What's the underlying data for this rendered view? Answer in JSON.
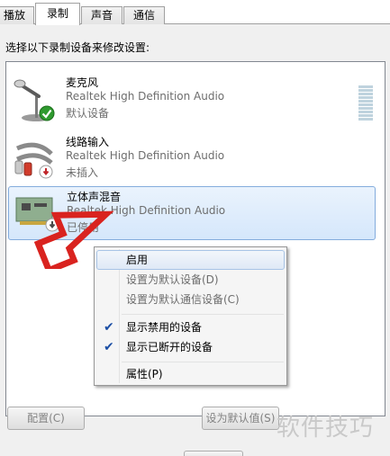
{
  "tabs": [
    {
      "label": "播放"
    },
    {
      "label": "录制"
    },
    {
      "label": "声音"
    },
    {
      "label": "通信"
    }
  ],
  "instruction": "选择以下录制设备来修改设置:",
  "devices": [
    {
      "name": "麦克风",
      "driver": "Realtek High Definition Audio",
      "status": "默认设备",
      "icon": "microphone-icon",
      "badge": "check-badge-icon"
    },
    {
      "name": "线路输入",
      "driver": "Realtek High Definition Audio",
      "status": "未插入",
      "icon": "line-in-cable-icon",
      "badge": "unplugged-badge-icon"
    },
    {
      "name": "立体声混音",
      "driver": "Realtek High Definition Audio",
      "status": "已停用",
      "icon": "sound-card-icon",
      "badge": "disabled-badge-icon"
    }
  ],
  "context_menu": {
    "items": [
      {
        "label": "启用",
        "enabled": true,
        "checked": false
      },
      {
        "label": "设置为默认设备(D)",
        "enabled": false,
        "checked": false
      },
      {
        "label": "设置为默认通信设备(C)",
        "enabled": false,
        "checked": false
      },
      {
        "label": "显示禁用的设备",
        "enabled": true,
        "checked": true
      },
      {
        "label": "显示已断开的设备",
        "enabled": true,
        "checked": true
      },
      {
        "label": "属性(P)",
        "enabled": true,
        "checked": false
      }
    ]
  },
  "buttons": {
    "configure": "配置(C)",
    "set_default": "设为默认值(S)"
  },
  "watermark": "软件技巧",
  "colors": {
    "selection_border": "#84acdd",
    "arrow_red": "#d9231f",
    "check_green": "#2f9a2f"
  }
}
